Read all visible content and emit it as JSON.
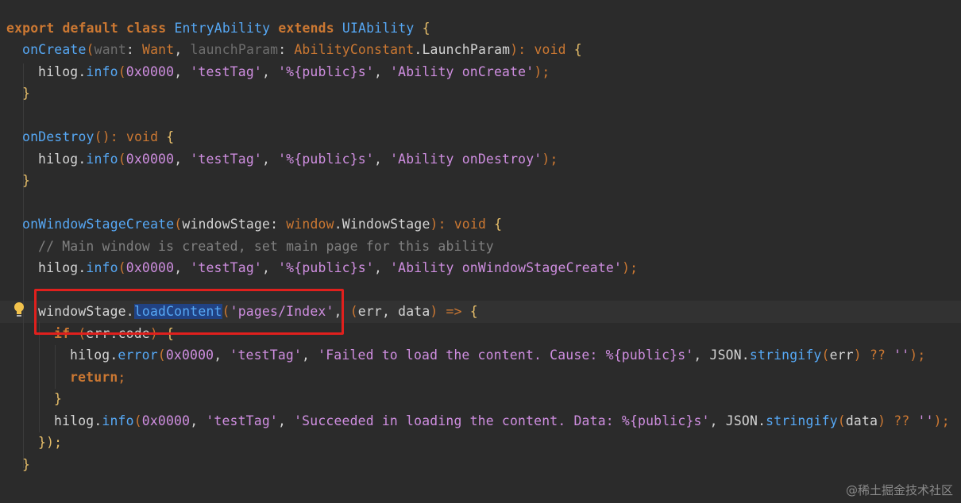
{
  "editor": {
    "watermark": "@稀土掘金技术社区",
    "lines": {
      "l1": {
        "kw1": "export default class ",
        "cls": "EntryAbility",
        "kw2": " extends ",
        "base": "UIAbility",
        "brace": " {"
      },
      "l2": {
        "fn": "onCreate",
        "p1": "(",
        "want": "want",
        "c1": ": ",
        "t1": "Want",
        "comma": ", ",
        "lp": "launchParam",
        "c2": ": ",
        "t2": "AbilityConstant",
        "dot": ".",
        "t3": "LaunchParam",
        "p2": "): ",
        "void": "void",
        "brace": " {"
      },
      "l3": {
        "obj": "hilog",
        "dot": ".",
        "fn": "info",
        "p1": "(",
        "num": "0x0000",
        "c1": ", ",
        "s1": "'testTag'",
        "c2": ", ",
        "s2": "'%{public}s'",
        "c3": ", ",
        "s3": "'Ability onCreate'",
        "end": ");"
      },
      "l4": {
        "brace": "}"
      },
      "l6": {
        "fn": "onDestroy",
        "p": "(): ",
        "void": "void",
        "brace": " {"
      },
      "l7": {
        "obj": "hilog",
        "dot": ".",
        "fn": "info",
        "p1": "(",
        "num": "0x0000",
        "c1": ", ",
        "s1": "'testTag'",
        "c2": ", ",
        "s2": "'%{public}s'",
        "c3": ", ",
        "s3": "'Ability onDestroy'",
        "end": ");"
      },
      "l8": {
        "brace": "}"
      },
      "l10": {
        "fn": "onWindowStageCreate",
        "p1": "(",
        "param": "windowStage",
        "c1": ": ",
        "t1": "window",
        "dot": ".",
        "t2": "WindowStage",
        "p2": "): ",
        "void": "void",
        "brace": " {"
      },
      "l11": {
        "comment": "// Main window is created, set main page for this ability"
      },
      "l12": {
        "obj": "hilog",
        "dot": ".",
        "fn": "info",
        "p1": "(",
        "num": "0x0000",
        "c1": ", ",
        "s1": "'testTag'",
        "c2": ", ",
        "s2": "'%{public}s'",
        "c3": ", ",
        "s3": "'Ability onWindowStageCreate'",
        "end": ");"
      },
      "l14": {
        "obj": "windowStage",
        "dot": ".",
        "fn": "loadContent",
        "p1": "(",
        "s1": "'pages/Index'",
        "c1": ", ",
        "p2": "(",
        "a1": "err",
        "c2": ", ",
        "a2": "data",
        "p3": ") ",
        "arrow": "=>",
        "brace": " {"
      },
      "l15": {
        "kw": "if",
        "p1": " (",
        "obj": "err",
        "dot": ".",
        "prop": "code",
        "p2": ") ",
        "brace": "{"
      },
      "l16": {
        "obj": "hilog",
        "dot": ".",
        "fn": "error",
        "p1": "(",
        "num": "0x0000",
        "c1": ", ",
        "s1": "'testTag'",
        "c2": ", ",
        "s2": "'Failed to load the content. Cause: %{public}s'",
        "c3": ", ",
        "json": "JSON",
        "dot2": ".",
        "fn2": "stringify",
        "p2": "(",
        "arg": "err",
        "p3": ") ",
        "op": "??",
        "sp": " ",
        "s3": "''",
        "end": ");"
      },
      "l17": {
        "kw": "return",
        "end": ";"
      },
      "l18": {
        "brace": "}"
      },
      "l19": {
        "obj": "hilog",
        "dot": ".",
        "fn": "info",
        "p1": "(",
        "num": "0x0000",
        "c1": ", ",
        "s1": "'testTag'",
        "c2": ", ",
        "s2": "'Succeeded in loading the content. Data: %{public}s'",
        "c3": ", ",
        "json": "JSON",
        "dot2": ".",
        "fn2": "stringify",
        "p2": "(",
        "arg": "data",
        "p3": ") ",
        "op": "??",
        "sp": " ",
        "s3": "''",
        "end": ");"
      },
      "l20": {
        "end": "});"
      },
      "l21": {
        "brace": "}"
      }
    }
  }
}
